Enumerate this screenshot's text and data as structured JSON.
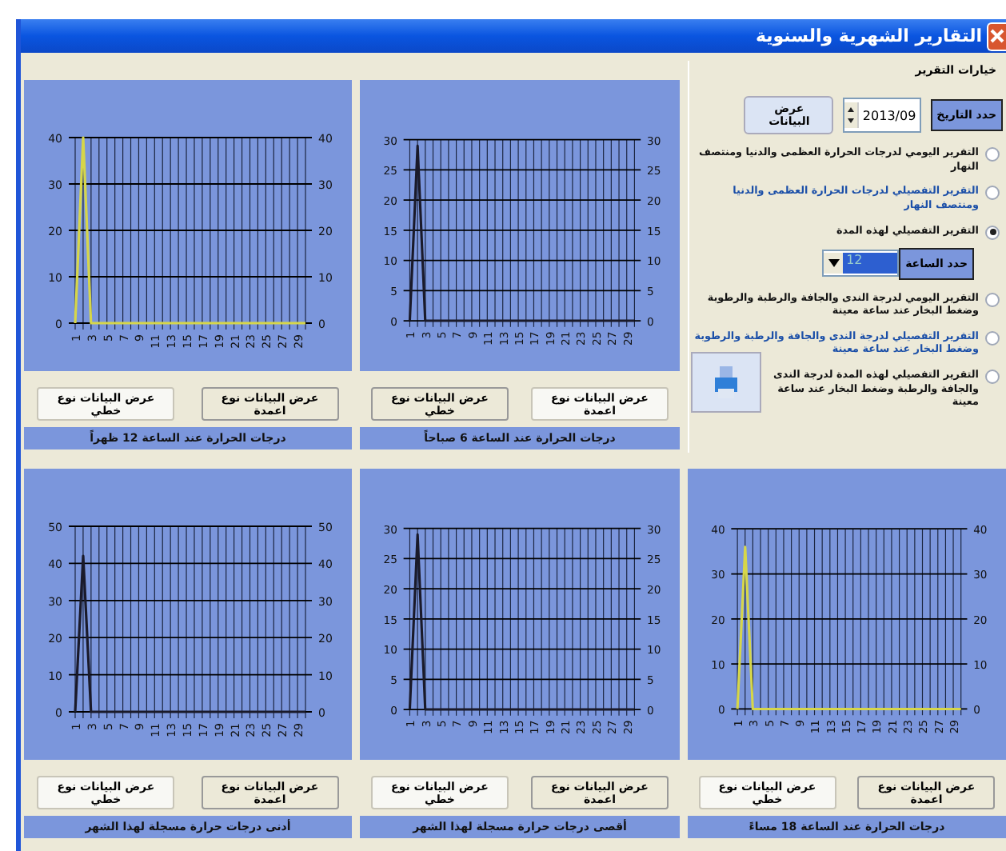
{
  "window": {
    "title": "التقارير الشهرية والسنوية"
  },
  "report_options": {
    "group_title": "خيارات التقرير",
    "date_label": "حدد التاريخ",
    "date_value": "2013/09",
    "show_button": "عرض البيانات",
    "hour_label": "حدد الساعة",
    "hour_value": "12",
    "reports": [
      {
        "label": "التقرير اليومي لدرجات الحرارة العظمى والدنيا ومنتصف النهار",
        "selected": false,
        "highlighted": false
      },
      {
        "label": "التقرير التفصيلي لدرجات الحرارة العظمى والدنيا ومنتصف النهار",
        "selected": false,
        "highlighted": true
      },
      {
        "label": "التقرير التفصيلي لهذه المدة",
        "selected": true,
        "highlighted": false
      },
      {
        "label": "التقرير اليومي لدرجة الندى والجافة والرطبة والرطوبة وضغط البخار عند ساعة معينة",
        "selected": false,
        "highlighted": false
      },
      {
        "label": "التقرير التفصيلي لدرجة الندى والجافة والرطبة والرطوبة وضغط البخار عند ساعة معينة",
        "selected": false,
        "highlighted": true
      },
      {
        "label": "التقرير التفصيلي لهذه المدة لدرجة الندى والجافة والرطبة وضغط البخار عند ساعة معينة",
        "selected": false,
        "highlighted": false
      }
    ]
  },
  "top_charts": [
    {
      "chart_data": {
        "type": "line",
        "x": [
          1,
          2,
          3,
          4,
          5,
          6,
          7,
          8,
          9,
          10,
          11,
          12,
          13,
          14,
          15,
          16,
          17,
          18,
          19,
          20,
          21,
          22,
          23,
          24,
          25,
          26,
          27,
          28,
          29,
          30
        ],
        "series": [
          {
            "color": "#1a1a2a",
            "values": [
              0,
              29,
              0,
              0,
              0,
              0,
              0,
              0,
              0,
              0,
              0,
              0,
              0,
              0,
              0,
              0,
              0,
              0,
              0,
              0,
              0,
              0,
              0,
              0,
              0,
              0,
              0,
              0,
              0,
              0
            ]
          }
        ],
        "xlim": [
          1,
          30
        ],
        "ylim": [
          0,
          30
        ],
        "y2lim": [
          0,
          30
        ],
        "yticks": [
          0,
          5,
          10,
          15,
          20,
          25,
          30
        ],
        "y2ticks": [
          0,
          5,
          10,
          15,
          20,
          25,
          30
        ],
        "xticks": [
          1,
          3,
          5,
          7,
          9,
          11,
          13,
          15,
          17,
          19,
          21,
          23,
          25,
          27,
          29
        ],
        "grid": true
      },
      "buttons": [
        {
          "label": "عرض البيانات نوع اعمدة",
          "selected": true
        },
        {
          "label": "عرض البيانات نوع خطي",
          "selected": false
        }
      ],
      "caption": "درجات الحرارة عند الساعة 6 صباحاً"
    },
    {
      "chart_data": {
        "type": "line",
        "x": [
          1,
          2,
          3,
          4,
          5,
          6,
          7,
          8,
          9,
          10,
          11,
          12,
          13,
          14,
          15,
          16,
          17,
          18,
          19,
          20,
          21,
          22,
          23,
          24,
          25,
          26,
          27,
          28,
          29,
          30
        ],
        "series": [
          {
            "color": "#d6d64a",
            "values": [
              0,
              40,
              0,
              0,
              0,
              0,
              0,
              0,
              0,
              0,
              0,
              0,
              0,
              0,
              0,
              0,
              0,
              0,
              0,
              0,
              0,
              0,
              0,
              0,
              0,
              0,
              0,
              0,
              0,
              0
            ]
          }
        ],
        "xlim": [
          1,
          30
        ],
        "ylim": [
          0,
          40
        ],
        "y2lim": [
          0,
          40
        ],
        "yticks": [
          0,
          10,
          20,
          30,
          40
        ],
        "y2ticks": [
          0,
          10,
          20,
          30,
          40
        ],
        "xticks": [
          1,
          3,
          5,
          7,
          9,
          11,
          13,
          15,
          17,
          19,
          21,
          23,
          25,
          27,
          29
        ],
        "grid": true
      },
      "buttons": [
        {
          "label": "عرض البيانات نوع اعمدة",
          "selected": false
        },
        {
          "label": "عرض البيانات نوع خطي",
          "selected": true
        }
      ],
      "caption": "درجات الحرارة عند الساعة 12 ظهراً"
    }
  ],
  "bottom_charts": [
    {
      "chart_data": {
        "type": "line",
        "x": [
          1,
          2,
          3,
          4,
          5,
          6,
          7,
          8,
          9,
          10,
          11,
          12,
          13,
          14,
          15,
          16,
          17,
          18,
          19,
          20,
          21,
          22,
          23,
          24,
          25,
          26,
          27,
          28,
          29,
          30
        ],
        "series": [
          {
            "color": "#d6d64a",
            "values": [
              0,
              36,
              0,
              0,
              0,
              0,
              0,
              0,
              0,
              0,
              0,
              0,
              0,
              0,
              0,
              0,
              0,
              0,
              0,
              0,
              0,
              0,
              0,
              0,
              0,
              0,
              0,
              0,
              0,
              0
            ]
          }
        ],
        "xlim": [
          1,
          30
        ],
        "ylim": [
          0,
          40
        ],
        "y2lim": [
          0,
          40
        ],
        "yticks": [
          0,
          10,
          20,
          30,
          40
        ],
        "y2ticks": [
          0,
          10,
          20,
          30,
          40
        ],
        "xticks": [
          1,
          3,
          5,
          7,
          9,
          11,
          13,
          15,
          17,
          19,
          21,
          23,
          25,
          27,
          29
        ],
        "grid": true
      },
      "buttons": [
        {
          "label": "عرض البيانات نوع اعمدة",
          "selected": false
        },
        {
          "label": "عرض البيانات نوع خطي",
          "selected": true
        }
      ],
      "caption": "درجات الحرارة عند الساعة 18 مساءً"
    },
    {
      "chart_data": {
        "type": "line",
        "x": [
          1,
          2,
          3,
          4,
          5,
          6,
          7,
          8,
          9,
          10,
          11,
          12,
          13,
          14,
          15,
          16,
          17,
          18,
          19,
          20,
          21,
          22,
          23,
          24,
          25,
          26,
          27,
          28,
          29,
          30
        ],
        "series": [
          {
            "color": "#1a1a2a",
            "values": [
              0,
              29,
              0,
              0,
              0,
              0,
              0,
              0,
              0,
              0,
              0,
              0,
              0,
              0,
              0,
              0,
              0,
              0,
              0,
              0,
              0,
              0,
              0,
              0,
              0,
              0,
              0,
              0,
              0,
              0
            ]
          }
        ],
        "xlim": [
          1,
          30
        ],
        "ylim": [
          0,
          30
        ],
        "y2lim": [
          0,
          30
        ],
        "yticks": [
          0,
          5,
          10,
          15,
          20,
          25,
          30
        ],
        "y2ticks": [
          0,
          5,
          10,
          15,
          20,
          25,
          30
        ],
        "xticks": [
          1,
          3,
          5,
          7,
          9,
          11,
          13,
          15,
          17,
          19,
          21,
          23,
          25,
          27,
          29
        ],
        "grid": true
      },
      "buttons": [
        {
          "label": "عرض البيانات نوع اعمدة",
          "selected": false
        },
        {
          "label": "عرض البيانات نوع خطي",
          "selected": true
        }
      ],
      "caption": "أقصى درجات حرارة مسجلة لهذا الشهر"
    },
    {
      "chart_data": {
        "type": "line",
        "x": [
          1,
          2,
          3,
          4,
          5,
          6,
          7,
          8,
          9,
          10,
          11,
          12,
          13,
          14,
          15,
          16,
          17,
          18,
          19,
          20,
          21,
          22,
          23,
          24,
          25,
          26,
          27,
          28,
          29,
          30
        ],
        "series": [
          {
            "color": "#1a1a2a",
            "values": [
              0,
              42,
              0,
              0,
              0,
              0,
              0,
              0,
              0,
              0,
              0,
              0,
              0,
              0,
              0,
              0,
              0,
              0,
              0,
              0,
              0,
              0,
              0,
              0,
              0,
              0,
              0,
              0,
              0,
              0
            ]
          }
        ],
        "xlim": [
          1,
          30
        ],
        "ylim": [
          0,
          50
        ],
        "y2lim": [
          0,
          50
        ],
        "yticks": [
          0,
          10,
          20,
          30,
          40,
          50
        ],
        "y2ticks": [
          0,
          10,
          20,
          30,
          40,
          50
        ],
        "xticks": [
          1,
          3,
          5,
          7,
          9,
          11,
          13,
          15,
          17,
          19,
          21,
          23,
          25,
          27,
          29
        ],
        "grid": true
      },
      "buttons": [
        {
          "label": "عرض البيانات نوع اعمدة",
          "selected": false
        },
        {
          "label": "عرض البيانات نوع خطي",
          "selected": true
        }
      ],
      "caption": "أدنى درجات حرارة مسجلة لهذا الشهر"
    }
  ]
}
